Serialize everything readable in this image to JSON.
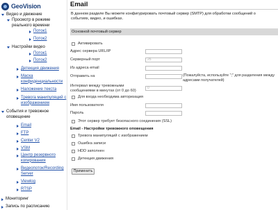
{
  "brand": {
    "name": "GeoVision"
  },
  "sidebar": {
    "items": [
      {
        "label": "Видео и движение",
        "kind": "section"
      },
      {
        "label": "Просмотр в режиме реального времени",
        "kind": "group"
      },
      {
        "label": "Поток1",
        "kind": "link"
      },
      {
        "label": "Поток2",
        "kind": "link"
      },
      {
        "label": "Настройки видео",
        "kind": "group"
      },
      {
        "label": "Поток1",
        "kind": "link"
      },
      {
        "label": "Поток2",
        "kind": "link"
      },
      {
        "label": "Детекция движения",
        "kind": "link"
      },
      {
        "label": "Маска конфиденциальности",
        "kind": "link"
      },
      {
        "label": "Наложение текста",
        "kind": "link"
      },
      {
        "label": "Тревога манипуляций с изображением",
        "kind": "link"
      },
      {
        "label": "События и тревожное оповещение",
        "kind": "section"
      },
      {
        "label": "Email",
        "kind": "link"
      },
      {
        "label": "FTP",
        "kind": "link"
      },
      {
        "label": "Center V2",
        "kind": "link"
      },
      {
        "label": "VSM",
        "kind": "link"
      },
      {
        "label": "Центр резервного копирования",
        "kind": "link"
      },
      {
        "label": "Видеопоток/Recording Server",
        "kind": "link"
      },
      {
        "label": "Viewlog",
        "kind": "link"
      },
      {
        "label": "RTSP",
        "kind": "link"
      },
      {
        "label": "Мониторинг",
        "kind": "section"
      },
      {
        "label": "Запись по расписанию",
        "kind": "section"
      }
    ]
  },
  "main": {
    "title": "Email",
    "description": "В данном разделе Вы можете конфигурировать почтовый сервер (SMTP) для обработки сообщений о событиях, видео, и ошибках.",
    "section_title": "Основной почтовый сервер",
    "form": {
      "activate_label": "Активировать",
      "server_label": "Адрес сервера URL/IP",
      "server_value": "",
      "port_label": "Серверный порт",
      "port_value": "25",
      "from_label": "Из адреса email",
      "from_value": "",
      "to_label": "Отправить на",
      "to_value": "",
      "to_hint": "(Пожалуйста, используйте \";\" для разделения между адресами получателей)",
      "interval_label": "Интервал между тревожными сообщениями в минутах (от 0 до 60)",
      "interval_value": "0",
      "auth_label": "Для входа необходима авторизация",
      "user_label": "Имя пользователя",
      "user_value": "",
      "password_label": "Пароль",
      "password_value": "",
      "ssl_label": "Этот сервер требует безопасного соединения (SSL)"
    },
    "alarm_section_title": "Email - Настройки тревожного оповещения",
    "alarms": [
      {
        "label": "Тревога манипуляций с изображением"
      },
      {
        "label": "Ошибка записи"
      },
      {
        "label": "HDD заполнен"
      },
      {
        "label": "Детекция движения"
      }
    ],
    "apply_label": "Применить"
  }
}
